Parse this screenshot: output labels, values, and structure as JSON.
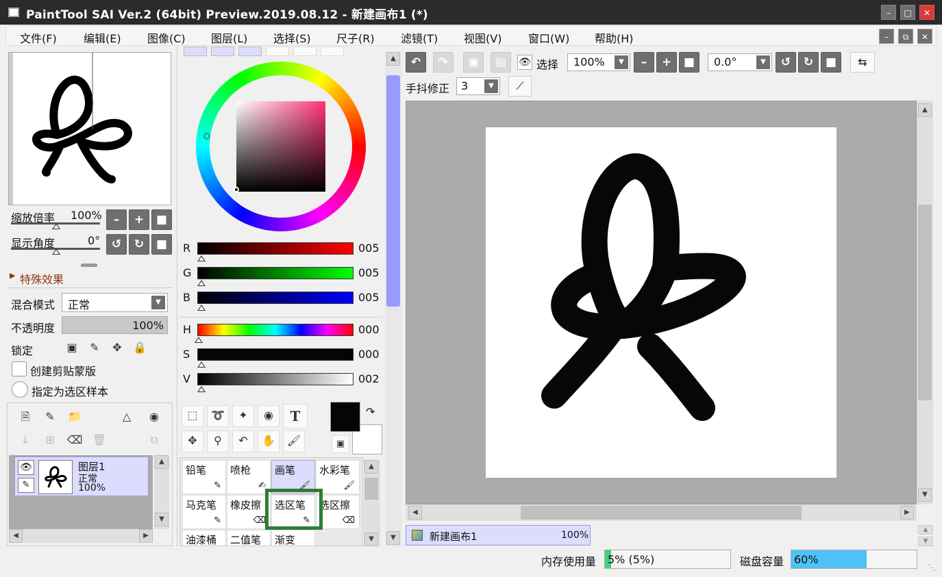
{
  "window": {
    "title": "PaintTool SAI Ver.2 (64bit) Preview.2019.08.12 - 新建画布1 (*)"
  },
  "menu": [
    "文件(F)",
    "编辑(E)",
    "图像(C)",
    "图层(L)",
    "选择(S)",
    "尺子(R)",
    "滤镜(T)",
    "视图(V)",
    "窗口(W)",
    "帮助(H)"
  ],
  "navigator": {
    "zoom_label": "缩放倍率",
    "zoom_value": "100%",
    "angle_label": "显示角度",
    "angle_value": "0°",
    "effects_label": "特殊效果"
  },
  "layer_props": {
    "blend_label": "混合模式",
    "blend_value": "正常",
    "opacity_label": "不透明度",
    "opacity_value": "100%",
    "opacity": 1.0,
    "lock_label": "锁定",
    "clip_label": "创建剪贴蒙版",
    "sample_label": "指定为选区样本"
  },
  "layers": [
    {
      "name": "图层1",
      "mode": "正常",
      "opacity": "100%"
    }
  ],
  "color": {
    "rgb": [
      {
        "label": "R",
        "value": "005"
      },
      {
        "label": "G",
        "value": "005"
      },
      {
        "label": "B",
        "value": "005"
      }
    ],
    "hsv": [
      {
        "label": "H",
        "value": "000"
      },
      {
        "label": "S",
        "value": "000"
      },
      {
        "label": "V",
        "value": "002"
      }
    ],
    "foreground": "#050505",
    "background": "#ffffff"
  },
  "tools": [
    [
      {
        "label": "铅笔",
        "icon": "pencil-icon"
      },
      {
        "label": "喷枪",
        "icon": "airbrush-icon"
      },
      {
        "label": "画笔",
        "icon": "brush-icon",
        "selected": true
      },
      {
        "label": "水彩笔",
        "icon": "watercolor-icon"
      }
    ],
    [
      {
        "label": "马克笔",
        "icon": "marker-icon"
      },
      {
        "label": "橡皮擦",
        "icon": "eraser-icon"
      },
      {
        "label": "选区笔",
        "icon": "selection-pen-icon",
        "highlighted": true
      },
      {
        "label": "选区擦",
        "icon": "selection-eraser-icon"
      }
    ],
    [
      {
        "label": "油漆桶",
        "icon": "bucket-icon"
      },
      {
        "label": "二值笔",
        "icon": "binary-pen-icon"
      },
      {
        "label": "渐变",
        "icon": "gradient-icon"
      }
    ]
  ],
  "canvas_toolbar": {
    "select_label": "选择",
    "zoom_value": "100%",
    "angle_value": "0.0°",
    "stabilizer_label": "手抖修正",
    "stabilizer_value": "3"
  },
  "canvas_tabs": [
    {
      "name": "新建画布1",
      "zoom": "100%"
    }
  ],
  "status": {
    "memory_label": "内存使用量",
    "memory_value": "5% (5%)",
    "memory_fraction": 0.05,
    "disk_label": "磁盘容量",
    "disk_value": "60%",
    "disk_fraction": 0.6
  },
  "colors": {
    "accent": "#9999ff",
    "highlight_box": "#2e7d32",
    "memory_bar": "#40d080",
    "disk_bar": "#4fc3f7"
  }
}
